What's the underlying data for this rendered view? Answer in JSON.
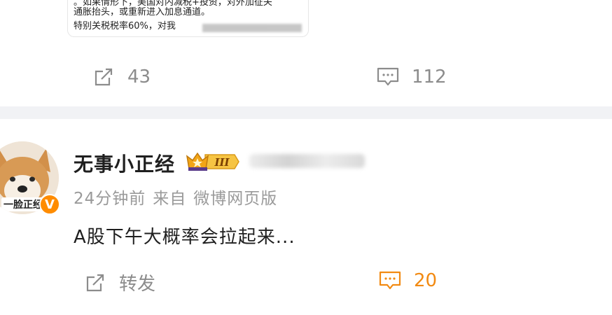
{
  "post1": {
    "quote_lines": [
      "。如果情形下，美国对内减税+投资，对外加征关",
      "通胀抬头，或重新进入加息通道。",
      "特别关税税率60%，对我"
    ],
    "actions": {
      "repost_count": "43",
      "comment_count": "112"
    }
  },
  "post2": {
    "username": "无事小正经",
    "badge_level": "III",
    "avatar_text": "一脸正经",
    "verified_mark": "V",
    "time": "24分钟前",
    "source_prefix": "来自",
    "source": "微博网页版",
    "text": "A股下午大概率会拉起来...",
    "actions": {
      "repost_label": "转发",
      "comment_count": "20"
    }
  },
  "colors": {
    "comment_active": "#f28a12",
    "icon_gray": "#8c8c8c",
    "verified_badge": "#ff8c00",
    "separator": "#f1f2f5"
  }
}
